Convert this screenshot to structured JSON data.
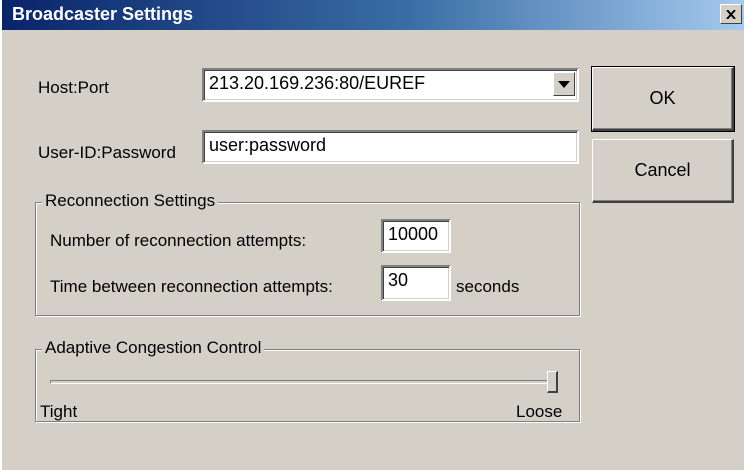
{
  "window": {
    "title": "Broadcaster Settings"
  },
  "fields": {
    "host_port_label": "Host:Port",
    "host_port_value": "213.20.169.236:80/EUREF",
    "credentials_label": "User-ID:Password",
    "credentials_value": "user:password"
  },
  "buttons": {
    "ok": "OK",
    "cancel": "Cancel"
  },
  "reconnection": {
    "legend": "Reconnection Settings",
    "attempts_label": "Number of reconnection attempts:",
    "attempts_value": "10000",
    "interval_label": "Time between reconnection attempts:",
    "interval_value": "30",
    "interval_unit": "seconds"
  },
  "congestion": {
    "legend": "Adaptive Congestion Control",
    "min_label": "Tight",
    "max_label": "Loose",
    "slider_fraction": 1.0
  },
  "icons": {
    "close": "close-icon",
    "dropdown": "chevron-down-icon"
  }
}
